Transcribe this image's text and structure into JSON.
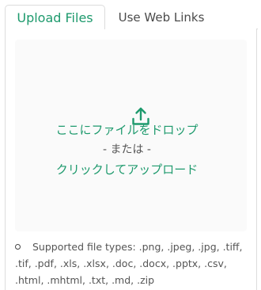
{
  "tabs": [
    {
      "label": "Upload Files",
      "active": true
    },
    {
      "label": "Use Web Links",
      "active": false
    }
  ],
  "dropzone": {
    "icon": "upload-icon",
    "primary_text": "ここにファイルをドロップ",
    "or_text": "- または -",
    "click_text": "クリックしてアップロード"
  },
  "supported": {
    "text": "Supported file types: .png, .jpeg, .jpg, .tiff, .tif, .pdf, .xls, .xlsx, .doc, .docx, .pptx, .csv, .html, .mhtml, .txt, .md, .zip"
  },
  "colors": {
    "accent": "#1e9a6d",
    "border": "#dcdcdc",
    "dropzone_bg": "#fafafa"
  }
}
